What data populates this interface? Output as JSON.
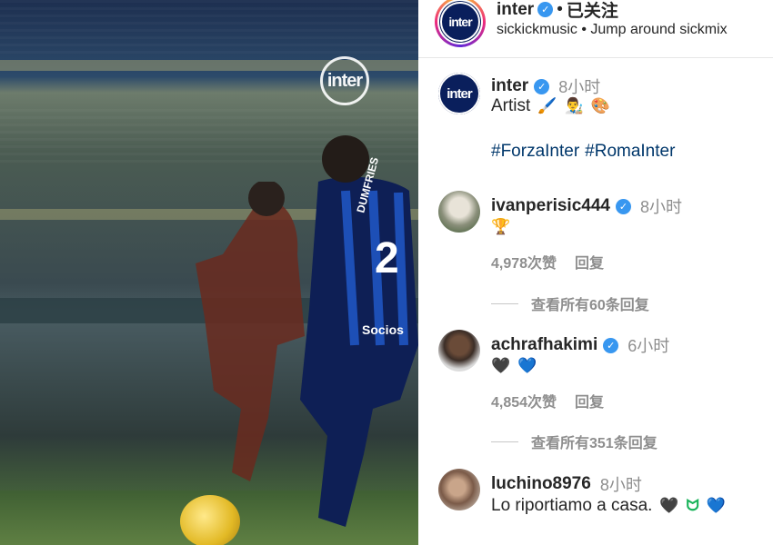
{
  "video": {
    "watermark_label": "inter",
    "player_number": "2",
    "player_name": "DUMFRIES",
    "sponsor": "Socios"
  },
  "header": {
    "username": "inter",
    "separator": "•",
    "follow_status": "已关注",
    "subtitle": "sickickmusic • Jump around sickmix",
    "avatar_label": "inter"
  },
  "caption": {
    "username": "inter",
    "time": "8小时",
    "text": "Artist",
    "emojis": [
      "🖌️",
      "👨‍🎨",
      "🎨"
    ],
    "hashtags": [
      "#ForzaInter",
      "#RomaInter"
    ]
  },
  "comments": [
    {
      "username": "ivanperisic444",
      "time": "8小时",
      "text": "",
      "emojis": [
        "🏆"
      ],
      "likes": "4,978次赞",
      "reply_label": "回复",
      "view_replies": "查看所有60条回复"
    },
    {
      "username": "achrafhakimi",
      "time": "6小时",
      "text": "",
      "emojis": [
        "🖤",
        "💙"
      ],
      "likes": "4,854次赞",
      "reply_label": "回复",
      "view_replies": "查看所有351条回复"
    },
    {
      "username": "luchino8976",
      "time": "8小时",
      "text": "Lo riportiamo a casa.",
      "emojis": [
        "🖤",
        "ᗢ",
        "💙"
      ]
    }
  ],
  "colors": {
    "verified": "#3897f0",
    "hashtag": "#00376b",
    "inter_blue": "#0a1f5c",
    "meta_gray": "#8e8e8e"
  },
  "icons": {
    "verified": "verified-badge-icon",
    "logo": "inter-logo-icon"
  }
}
